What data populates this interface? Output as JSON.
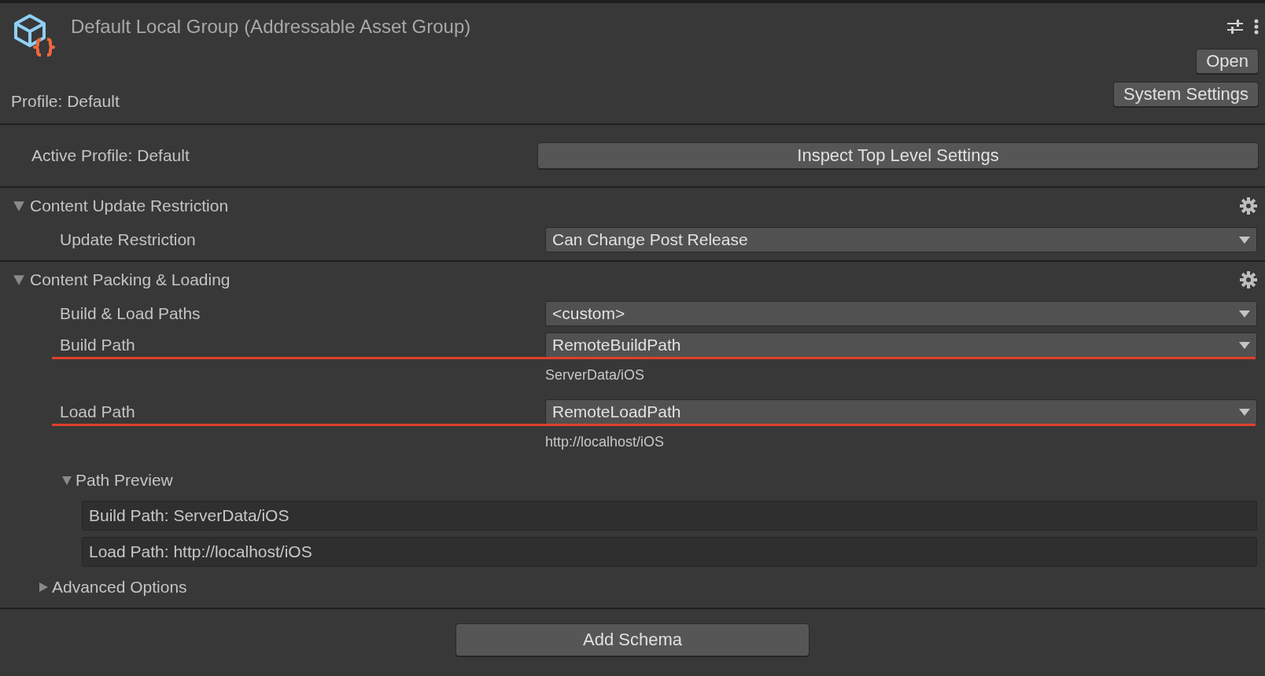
{
  "header": {
    "title": "Default Local Group (Addressable Asset Group)",
    "profile": "Profile: Default",
    "buttons": [
      "Open",
      "System Settings"
    ]
  },
  "active_profile": {
    "label": "Active Profile: Default",
    "button": "Inspect Top Level Settings"
  },
  "sections": [
    {
      "title": "Content Update Restriction",
      "expanded": true,
      "rows": [
        {
          "kind": "dropdown",
          "label": "Update Restriction",
          "value": "Can Change Post Release",
          "highlighted": false
        }
      ]
    },
    {
      "title": "Content Packing & Loading",
      "expanded": true,
      "rows": [
        {
          "kind": "dropdown",
          "label": "Build & Load Paths",
          "value": "<custom>",
          "highlighted": false
        },
        {
          "kind": "dropdown",
          "label": "Build Path",
          "value": "RemoteBuildPath",
          "highlighted": true,
          "hint": "ServerData/iOS"
        },
        {
          "kind": "dropdown",
          "label": "Load Path",
          "value": "RemoteLoadPath",
          "highlighted": true,
          "hint": "http://localhost/iOS"
        },
        {
          "kind": "foldout",
          "label": "Path Preview",
          "expanded": true,
          "fields": [
            "Build Path: ServerData/iOS",
            "Load Path: http://localhost/iOS"
          ]
        }
      ],
      "footer_foldouts": [
        {
          "label": "Advanced Options",
          "expanded": false
        }
      ]
    }
  ],
  "add_button": "Add Schema"
}
